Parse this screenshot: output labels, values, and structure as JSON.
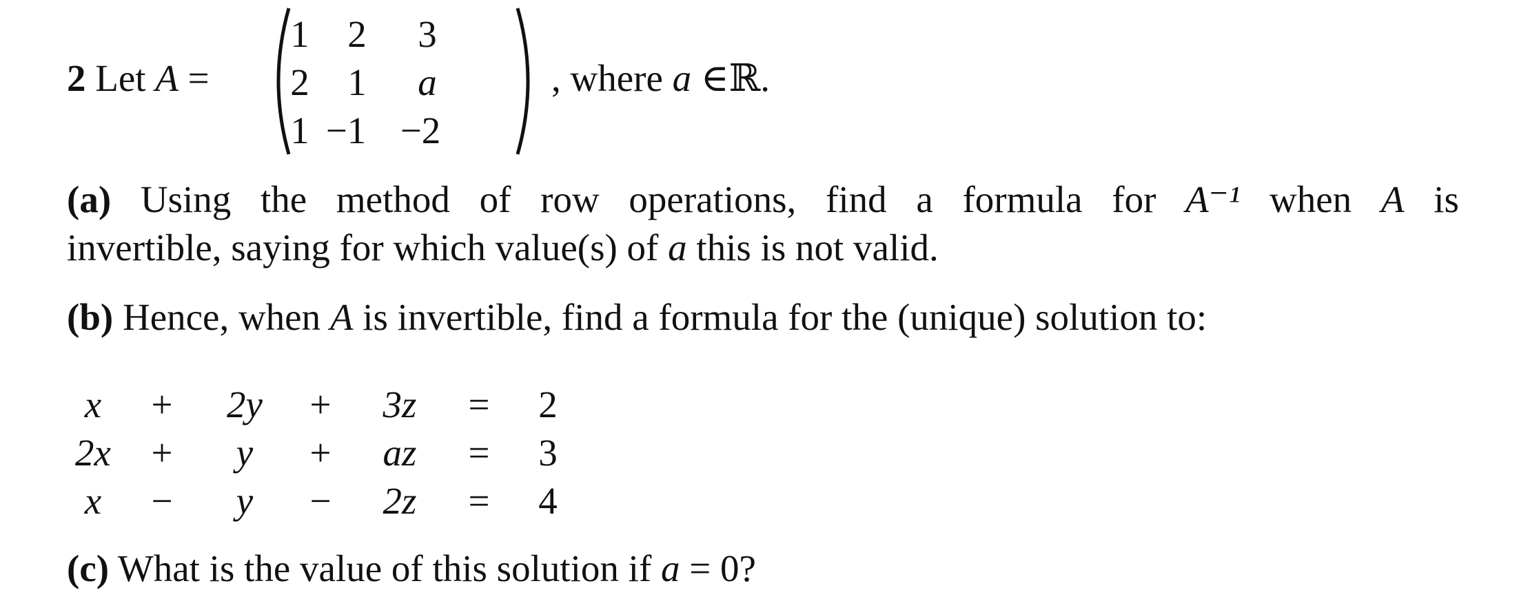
{
  "problem": {
    "number": "2",
    "intro": "Let",
    "matrix_name": "A",
    "equals": "=",
    "matrix": [
      [
        "1",
        "2",
        "3"
      ],
      [
        "2",
        "1",
        "a"
      ],
      [
        "1",
        "−1",
        "−2"
      ]
    ],
    "tail_comma": ",",
    "tail_where": "where",
    "tail_var": "a",
    "tail_in": "∈",
    "tail_set": "ℝ",
    "tail_period": "."
  },
  "parts": {
    "a": {
      "label": "(a)",
      "line1_words": [
        "Using",
        "the",
        "method",
        "of",
        "row",
        "operations,",
        "find",
        "a",
        "formula",
        "for",
        "A⁻¹",
        "when",
        "A",
        "is"
      ],
      "line2_pre": "invertible, saying for which value(s) of",
      "line2_var": "a",
      "line2_post": "this is not valid."
    },
    "b": {
      "label": "(b)",
      "pre": "Hence, when",
      "var": "A",
      "post": "is invertible, find a formula for the (unique) solution to:"
    },
    "c": {
      "label": "(c)",
      "pre": "What is the value of this solution if",
      "var": "a",
      "post": "= 0?"
    }
  },
  "system": {
    "rows": [
      [
        "x",
        "+",
        "2y",
        "+",
        "3z",
        "=",
        "2"
      ],
      [
        "2x",
        "+",
        "y",
        "+",
        "az",
        "=",
        "3"
      ],
      [
        "x",
        "−",
        "y",
        "−",
        "2z",
        "=",
        "4"
      ]
    ]
  }
}
